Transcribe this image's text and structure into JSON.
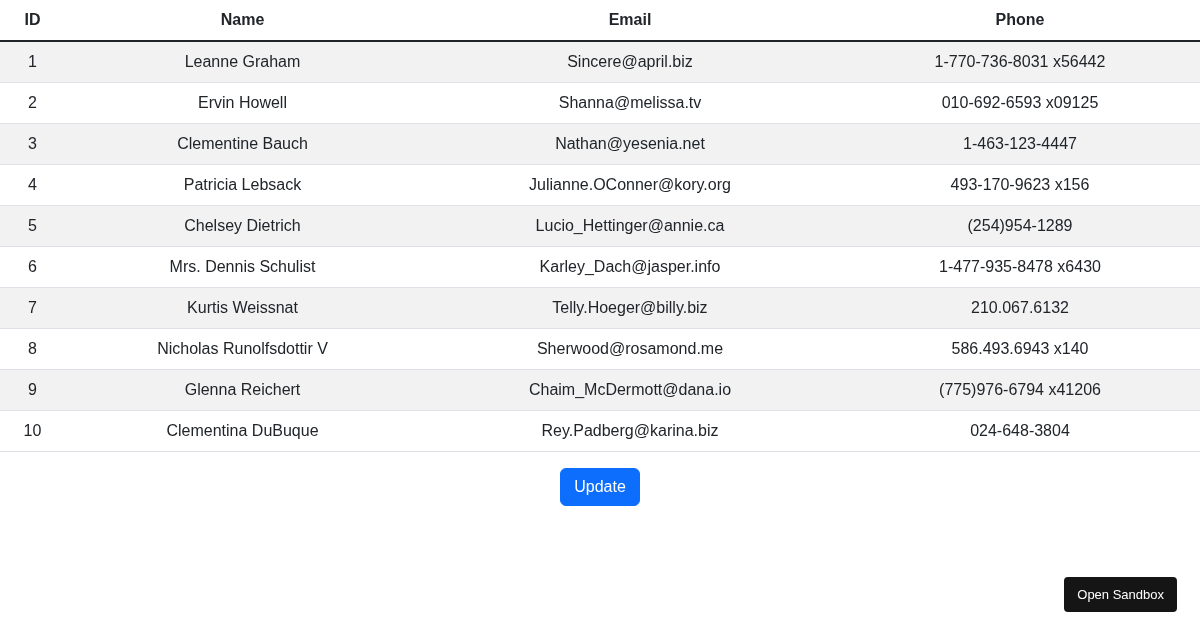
{
  "table": {
    "columns": [
      "ID",
      "Name",
      "Email",
      "Phone"
    ],
    "rows": [
      [
        "1",
        "Leanne Graham",
        "Sincere@april.biz",
        "1-770-736-8031 x56442"
      ],
      [
        "2",
        "Ervin Howell",
        "Shanna@melissa.tv",
        "010-692-6593 x09125"
      ],
      [
        "3",
        "Clementine Bauch",
        "Nathan@yesenia.net",
        "1-463-123-4447"
      ],
      [
        "4",
        "Patricia Lebsack",
        "Julianne.OConner@kory.org",
        "493-170-9623 x156"
      ],
      [
        "5",
        "Chelsey Dietrich",
        "Lucio_Hettinger@annie.ca",
        "(254)954-1289"
      ],
      [
        "6",
        "Mrs. Dennis Schulist",
        "Karley_Dach@jasper.info",
        "1-477-935-8478 x6430"
      ],
      [
        "7",
        "Kurtis Weissnat",
        "Telly.Hoeger@billy.biz",
        "210.067.6132"
      ],
      [
        "8",
        "Nicholas Runolfsdottir V",
        "Sherwood@rosamond.me",
        "586.493.6943 x140"
      ],
      [
        "9",
        "Glenna Reichert",
        "Chaim_McDermott@dana.io",
        "(775)976-6794 x41206"
      ],
      [
        "10",
        "Clementina DuBuque",
        "Rey.Padberg@karina.biz",
        "024-648-3804"
      ]
    ]
  },
  "update_button": "Update",
  "sandbox_button": "Open Sandbox"
}
